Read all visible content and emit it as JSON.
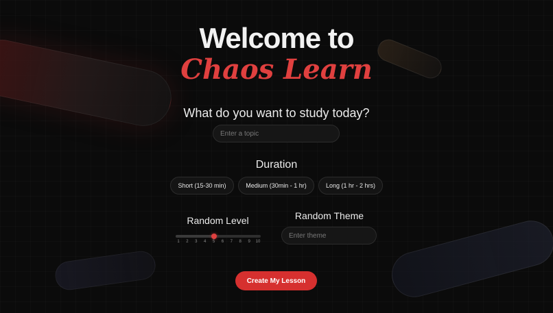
{
  "header": {
    "title_line1": "Welcome to",
    "title_line2": "Chaos Learn"
  },
  "topic": {
    "question": "What do you want to study today?",
    "placeholder": "Enter a topic",
    "value": ""
  },
  "duration": {
    "title": "Duration",
    "options": [
      {
        "label": "Short (15-30 min)"
      },
      {
        "label": "Medium (30min - 1 hr)"
      },
      {
        "label": "Long (1 hr - 2 hrs)"
      }
    ]
  },
  "random_level": {
    "title": "Random Level",
    "min": 1,
    "max": 10,
    "value": 5,
    "ticks": [
      "1",
      "2",
      "3",
      "4",
      "5",
      "6",
      "7",
      "8",
      "9",
      "10"
    ]
  },
  "random_theme": {
    "title": "Random Theme",
    "placeholder": "Enter theme",
    "value": ""
  },
  "actions": {
    "create_label": "Create My Lesson"
  },
  "colors": {
    "accent": "#e0403f",
    "button": "#d6302f",
    "background": "#0b0b0b"
  }
}
